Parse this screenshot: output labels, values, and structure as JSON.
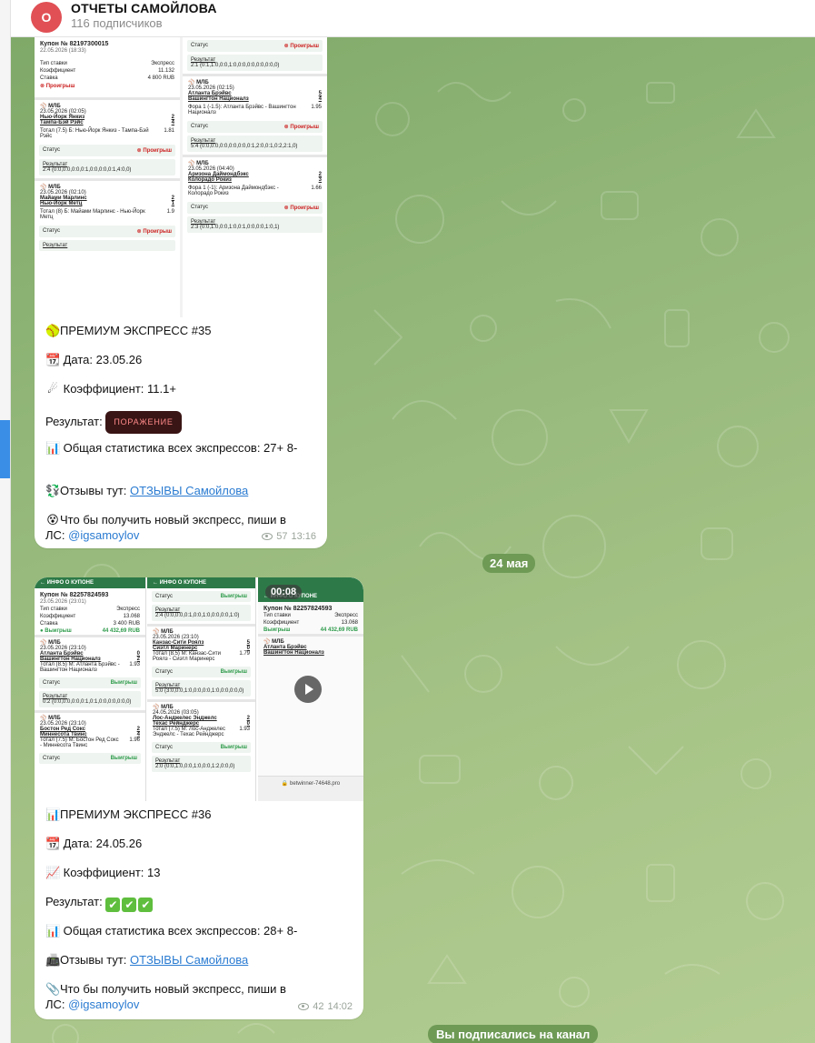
{
  "header": {
    "avatar_letter": "О",
    "title": "ОТЧЕТЫ САМОЙЛОВА",
    "subtitle": "116 подписчиков"
  },
  "message1": {
    "coupon": {
      "number": "Купон № 82197300015",
      "date": "22.05.2026 (18:33)",
      "bet_type_label": "Тип ставки",
      "bet_type": "Экспресс",
      "coef_label": "Коэффициент",
      "coef": "11.132",
      "stake_label": "Ставка",
      "stake": "4 800 RUB",
      "status": "Проигрыш",
      "events": [
        {
          "league": "МЛБ",
          "date": "23.05.2026 (02:05)",
          "team1": "Нью-Йорк Янкиз",
          "score1": "2",
          "team2": "Тампа-Бэй Рэйс",
          "score2": "4",
          "bet": "Тотал (7.5) Б: Нью-Йорк Янкиз - Тампа-Бэй Рэйс",
          "odd": "1.81",
          "status_label": "Статус",
          "status": "Проигрыш",
          "result_label": "Результат",
          "result": "2:4 (0:0,0:0,0:0,0:1,0:0,0:0,0:1,4:0,0)"
        },
        {
          "league": "МЛБ",
          "date": "23.05.2026 (02:10)",
          "team1": "Майами Марлинс",
          "score1": "2",
          "team2": "Нью-Йорк Метц",
          "score2": "1",
          "bet": "Тотал (8) Б: Майами Марлинс - Нью-Йорк Метц",
          "odd": "1.9",
          "status_label": "Статус",
          "status": "Проигрыш",
          "result_label": "Результат",
          "result": ""
        },
        {
          "league": "МЛБ",
          "date": "23.05.2026 (02:15)",
          "team1": "Атланта Брэйвс",
          "score1": "5",
          "team2": "Вашингтон Националз",
          "score2": "4",
          "bet": "Фора 1 (-1.5): Атланта Брэйвс - Вашингтон Националз",
          "odd": "1.95",
          "status_label": "Статус",
          "status": "Проигрыш",
          "result_label": "Результат",
          "result": "5:4 (0:0,0:0,0:0,0:0,0:0,0:1,2:0,0:1,0:2,2:1,0)"
        },
        {
          "league": "МЛБ",
          "date": "23.05.2026 (04:40)",
          "team1": "Аризона Даймондбэкс",
          "score1": "2",
          "team2": "Колорадо Рокиз",
          "score2": "3",
          "bet": "Фора 1 (-1): Аризона Даймондбэкс - Колорадо Рокиз",
          "odd": "1.66",
          "status_label": "Статус",
          "status": "Проигрыш",
          "result_label": "Результат",
          "result": "2:3 (0:0,1:0,0:0,1:0,0:1,0:0,0:0,1:0,1)"
        }
      ],
      "top_status_label": "Статус",
      "top_status": "Проигрыш",
      "top_result_label": "Результат",
      "top_result": "2:1 (0:1,1:0,0:0,1:0,0:0,0:0,0:0,0:0,0)"
    },
    "title_icon": "🥎",
    "title": "ПРЕМИУМ ЭКСПРЕСС #35",
    "date_icon": "📆",
    "date": "Дата: 23.05.26",
    "coef_icon": "☄",
    "coef": "Коэффициент: 11.1+",
    "result_label": "Результат:",
    "result_badge": "ПОРАЖЕНИЕ",
    "stats_icon": "📊",
    "stats": "Общая статистика всех экспрессов: 27+ 8-",
    "reviews_icon": "💱",
    "reviews_prefix": "Отзывы тут:",
    "reviews_link": "ОТЗЫВЫ Самойлова",
    "cta_icon": "😵",
    "cta": "Что бы получить новый экспресс, пиши в ЛС:",
    "cta_mention": "@igsamoylov",
    "views": "57",
    "time": "13:16"
  },
  "date_separator": "24 мая",
  "message2": {
    "header_text": "ИНФО О КУПОНЕ",
    "coupon": {
      "number": "Купон № 82257824593",
      "date": "23.05.2026 (23:01)",
      "bet_type_label": "Тип ставки",
      "bet_type": "Экспресс",
      "coef_label": "Коэффициент",
      "coef": "13.068",
      "stake_label": "Ставка",
      "stake": "3 400 RUB",
      "status": "Выигрыш",
      "win_amount": "44 432,69 RUB",
      "events": [
        {
          "league": "МЛБ",
          "date": "23.05.2026 (23:10)",
          "team1": "Атланта Брэйвс",
          "score1": "0",
          "team2": "Вашингтон Националз",
          "score2": "2",
          "bet": "Тотал (8.5) М: Атланта Брэйвс - Вашингтон Националз",
          "odd": "1.93",
          "status_label": "Статус",
          "status": "Выигрыш",
          "result_label": "Результат",
          "result": "0:2 (0:0,0:0,0:0,0:1,0:1,0:0,0:0,0:0,0)"
        },
        {
          "league": "МЛБ",
          "date": "23.05.2026 (23:10)",
          "team1": "Бостон Ред Сокс",
          "score1": "2",
          "team2": "Миннесота Твинс",
          "score2": "4",
          "bet": "Тотал (7.5) М: Бостон Ред Сокс - Миннесота Твинс",
          "odd": "1.96",
          "status_label": "Статус",
          "status": "Выигрыш",
          "result_label": "Результат",
          "result": ""
        },
        {
          "league": "МЛБ",
          "date": "23.05.2026 (23:10)",
          "team1": "Канзас-Сити Роялз",
          "score1": "5",
          "team2": "Сиэтл Маринерс",
          "score2": "0",
          "bet": "Тотал (8.5) М: Канзас-Сити Роялз - Сиэтл Маринерс",
          "odd": "1.79",
          "status_label": "Статус",
          "status": "Выигрыш",
          "result_label": "Результат",
          "result": "5:0 (3:0,0:0,1:0,0:0,0:0,1:0,0:0,0:0,0)"
        },
        {
          "league": "МЛБ",
          "date": "24.05.2026 (03:05)",
          "team1": "Лос-Анджелес Энджелс",
          "score1": "2",
          "team2": "Техас Рейнджерс",
          "score2": "0",
          "bet": "Тотал (7.5) М: Лос-Анджелес Энджелс - Техас Рейнджерс",
          "odd": "1.93",
          "status_label": "Статус",
          "status": "Выигрыш",
          "result_label": "Результат",
          "result": "2:0 (0:0,1:0,0:0,1:0,0:0,1:2,0:0,0)"
        }
      ],
      "top_status_label": "Статус",
      "top_status": "Выигрыш",
      "top_result_label": "Результат",
      "top_result": "2:4 (0:0,0:0,0:1,0:0,1:0,0:0,0:0,1:0)"
    },
    "video": {
      "duration": "00:08",
      "url": "betwinner-74648.pro"
    },
    "title_icon": "📊",
    "title": "ПРЕМИУМ ЭКСПРЕСС #36",
    "date_icon": "📆",
    "date": "Дата: 24.05.26",
    "coef_icon": "📈",
    "coef": "Коэффициент: 13",
    "result_label": "Результат:",
    "result_checks": [
      "✔",
      "✔",
      "✔"
    ],
    "stats_icon": "📊",
    "stats": "Общая статистика всех экспрессов: 28+ 8-",
    "reviews_icon": "📠",
    "reviews_prefix": "Отзывы тут:",
    "reviews_link": "ОТЗЫВЫ Самойлова",
    "cta_icon": "📎",
    "cta": "Что бы получить новый экспресс, пиши в ЛС:",
    "cta_mention": "@igsamoylov",
    "views": "42",
    "time": "14:02"
  },
  "service_message": "Вы подписались на канал",
  "colors": {
    "accent": "#2a7bd1",
    "chat_bg": "#9bbd7f",
    "pill_bg": "#6e9a55",
    "coupon_green": "#2d7a48",
    "lose_badge_bg": "#3a1515",
    "avatar_bg": "#e05055"
  }
}
